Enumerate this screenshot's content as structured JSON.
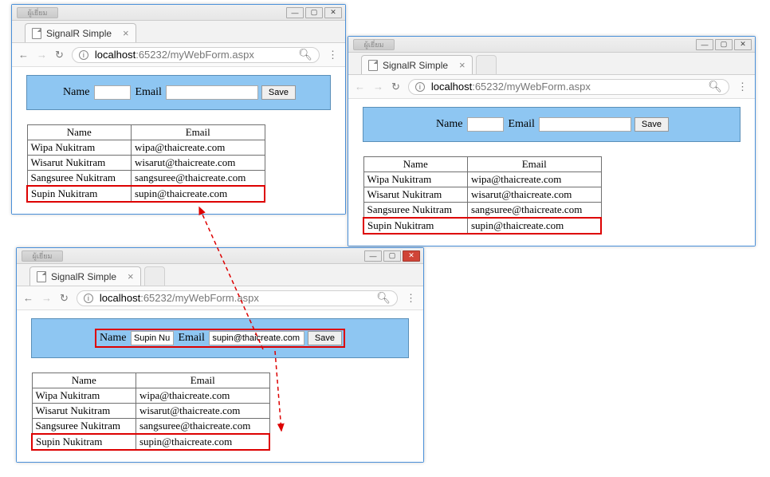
{
  "tab_title": "SignalR Simple",
  "url": {
    "host": "localhost",
    "rest": ":65232/myWebForm.aspx"
  },
  "titlebar_decor": "ผู้เยี่ยม",
  "form": {
    "name_label": "Name",
    "email_label": "Email",
    "save_label": "Save",
    "filled_name": "Supin Nuk",
    "filled_email": "supin@thaicreate.com"
  },
  "table": {
    "head_name": "Name",
    "head_email": "Email",
    "rows": [
      {
        "name": "Wipa Nukitram",
        "email": "wipa@thaicreate.com"
      },
      {
        "name": "Wisarut Nukitram",
        "email": "wisarut@thaicreate.com"
      },
      {
        "name": "Sangsuree Nukitram",
        "email": "sangsuree@thaicreate.com"
      },
      {
        "name": "Supin Nukitram",
        "email": "supin@thaicreate.com"
      }
    ]
  },
  "sys": {
    "min": "—",
    "max": "▢",
    "close": "✕"
  }
}
